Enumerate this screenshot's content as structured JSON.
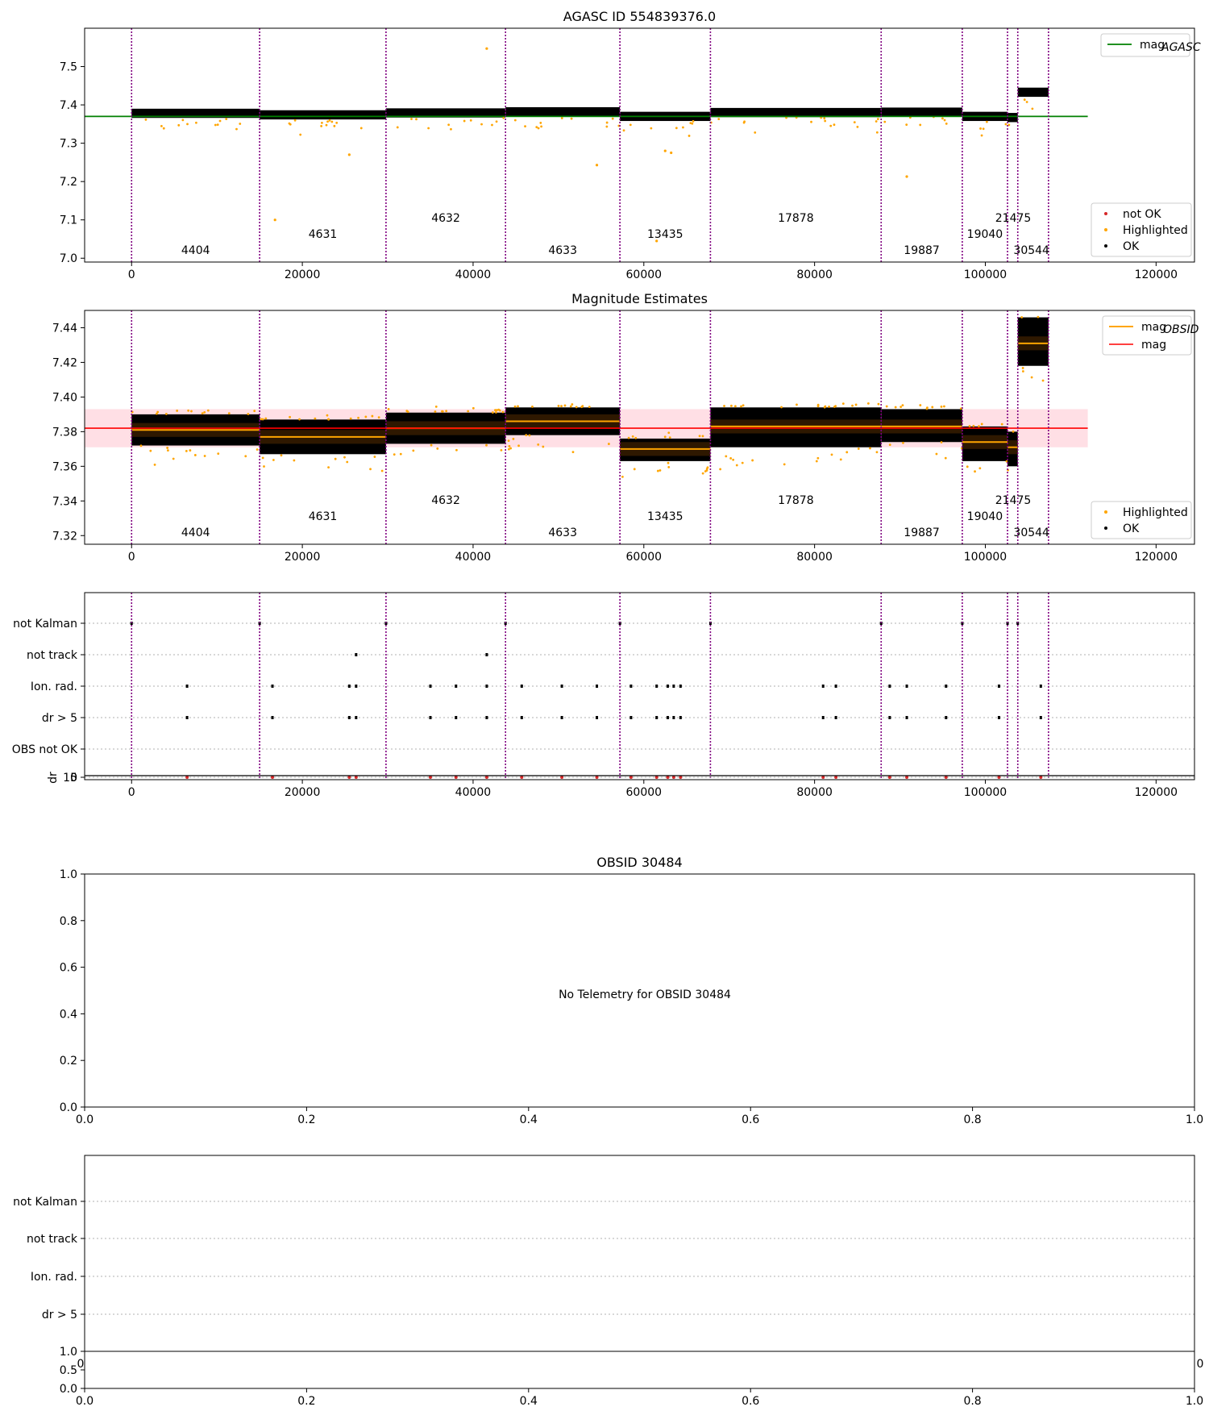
{
  "colors": {
    "ok": "#000000",
    "highlighted": "#ffa500",
    "not_ok": "#d62728",
    "agasc_line": "#008000",
    "obsid_line": "#ffa500",
    "mag_line": "#ff0000",
    "mag_band": "#ffc0cb",
    "obsid_divider": "#800080",
    "grid": "#b0b0b0"
  },
  "chart_data": [
    {
      "type": "scatter",
      "title": "AGASC ID 554839376.0",
      "xlim": [
        -5500,
        124500
      ],
      "ylim": [
        6.99,
        7.6
      ],
      "xticks": [
        0,
        20000,
        40000,
        60000,
        80000,
        100000,
        120000
      ],
      "yticks": [
        7.0,
        7.1,
        7.2,
        7.3,
        7.4,
        7.5
      ],
      "legend_lines": [
        {
          "label": "mag",
          "sub": "AGASC"
        }
      ],
      "legend_points": [
        "not OK",
        "Highlighted",
        "OK"
      ],
      "mag_agasc": 7.37,
      "obsid_boundaries": [
        0,
        15000,
        29800,
        43800,
        57200,
        67800,
        87800,
        97300,
        102600,
        103800,
        107400
      ],
      "obsids": [
        {
          "label": "4404",
          "x_range": [
            0,
            15000
          ],
          "mean": 7.378
        },
        {
          "label": "4631",
          "x_range": [
            15000,
            29800
          ],
          "mean": 7.374
        },
        {
          "label": "4632",
          "x_range": [
            29800,
            43800
          ],
          "mean": 7.379
        },
        {
          "label": "4633",
          "x_range": [
            43800,
            57200
          ],
          "mean": 7.382
        },
        {
          "label": "13435",
          "x_range": [
            57200,
            67800
          ],
          "mean": 7.37
        },
        {
          "label": "17878",
          "x_range": [
            67800,
            87800
          ],
          "mean": 7.38
        },
        {
          "label": "19887",
          "x_range": [
            87800,
            97300
          ],
          "mean": 7.381
        },
        {
          "label": "19040",
          "x_range": [
            97300,
            102600
          ],
          "mean": 7.37
        },
        {
          "label": "21475",
          "x_range": [
            102600,
            103800
          ],
          "mean": 7.367
        },
        {
          "label": "30544",
          "x_range": [
            103800,
            107400
          ],
          "mean": 7.433
        }
      ]
    },
    {
      "type": "scatter",
      "title": "Magnitude Estimates",
      "xlim": [
        -5500,
        124500
      ],
      "ylim": [
        7.315,
        7.45
      ],
      "xticks": [
        0,
        20000,
        40000,
        60000,
        80000,
        100000,
        120000
      ],
      "yticks": [
        7.32,
        7.34,
        7.36,
        7.38,
        7.4,
        7.42,
        7.44
      ],
      "legend_lines": [
        {
          "label": "mag",
          "sub": "OBSID"
        },
        {
          "label": "mag",
          "sub": ""
        }
      ],
      "legend_points": [
        "Highlighted",
        "OK"
      ],
      "mag": 7.382,
      "mag_band": [
        7.371,
        7.393
      ],
      "obsids": [
        {
          "label": "4404",
          "x_range": [
            0,
            15000
          ],
          "mean": 7.381,
          "spread": [
            7.372,
            7.39
          ]
        },
        {
          "label": "4631",
          "x_range": [
            15000,
            29800
          ],
          "mean": 7.377,
          "spread": [
            7.367,
            7.387
          ]
        },
        {
          "label": "4632",
          "x_range": [
            29800,
            43800
          ],
          "mean": 7.382,
          "spread": [
            7.373,
            7.391
          ]
        },
        {
          "label": "4633",
          "x_range": [
            43800,
            57200
          ],
          "mean": 7.386,
          "spread": [
            7.378,
            7.394
          ]
        },
        {
          "label": "13435",
          "x_range": [
            57200,
            67800
          ],
          "mean": 7.37,
          "spread": [
            7.363,
            7.376
          ]
        },
        {
          "label": "17878",
          "x_range": [
            67800,
            87800
          ],
          "mean": 7.383,
          "spread": [
            7.371,
            7.394
          ]
        },
        {
          "label": "19887",
          "x_range": [
            87800,
            97300
          ],
          "mean": 7.383,
          "spread": [
            7.374,
            7.393
          ]
        },
        {
          "label": "19040",
          "x_range": [
            97300,
            102600
          ],
          "mean": 7.374,
          "spread": [
            7.363,
            7.383
          ]
        },
        {
          "label": "21475",
          "x_range": [
            102600,
            103800
          ],
          "mean": 7.371,
          "spread": [
            7.36,
            7.38
          ]
        },
        {
          "label": "30544",
          "x_range": [
            103800,
            107400
          ],
          "mean": 7.431,
          "spread": [
            7.418,
            7.446
          ]
        }
      ]
    },
    {
      "type": "scatter",
      "title": "",
      "xlim": [
        -5500,
        124500
      ],
      "flag_labels": [
        "not Kalman",
        "not track",
        "Ion. rad.",
        "dr > 5",
        "OBS not OK"
      ],
      "flags": {
        "not Kalman": [
          0,
          15000,
          29800,
          43800,
          57200,
          67800,
          87800,
          97300,
          102600,
          103800
        ],
        "not track": [
          26300,
          41600
        ],
        "Ion. rad.": [
          6500,
          16500,
          25500,
          26300,
          35000,
          38000,
          41600,
          45700,
          50400,
          54500,
          58500,
          61500,
          62800,
          63500,
          64300,
          81000,
          82500,
          88800,
          90800,
          95400,
          101600,
          106500
        ],
        "dr > 5": [
          6500,
          16500,
          25500,
          26300,
          35000,
          38000,
          41600,
          45700,
          50400,
          54500,
          58500,
          61500,
          62800,
          63500,
          64300,
          81000,
          82500,
          88800,
          90800,
          95400,
          101600,
          106500
        ],
        "OBS not OK": []
      },
      "dr_ylabel": "dr",
      "dr_ylim": [
        0,
        10
      ],
      "dr_yticks": [
        0,
        5,
        10
      ],
      "xticks": [
        0,
        20000,
        40000,
        60000,
        80000,
        100000,
        120000
      ]
    },
    {
      "type": "scatter",
      "title": "OBSID 30484",
      "annotation": "No Telemetry for OBSID 30484",
      "xlim": [
        0,
        1
      ],
      "ylim": [
        0,
        1
      ],
      "xticks": [
        0.0,
        0.2,
        0.4,
        0.6,
        0.8,
        1.0
      ],
      "yticks": [
        0.0,
        0.2,
        0.4,
        0.6,
        0.8,
        1.0
      ]
    },
    {
      "type": "scatter",
      "title": "",
      "flag_labels": [
        "not Kalman",
        "not track",
        "Ion. rad.",
        "dr > 5"
      ],
      "xlim": [
        0,
        1
      ],
      "ylim": [
        0,
        1
      ],
      "xticks": [
        0.0,
        0.2,
        0.4,
        0.6,
        0.8,
        1.0
      ],
      "yticks": [
        0.0,
        0.5,
        1.0
      ],
      "overlap_xticks": [
        "0",
        "0"
      ]
    }
  ]
}
